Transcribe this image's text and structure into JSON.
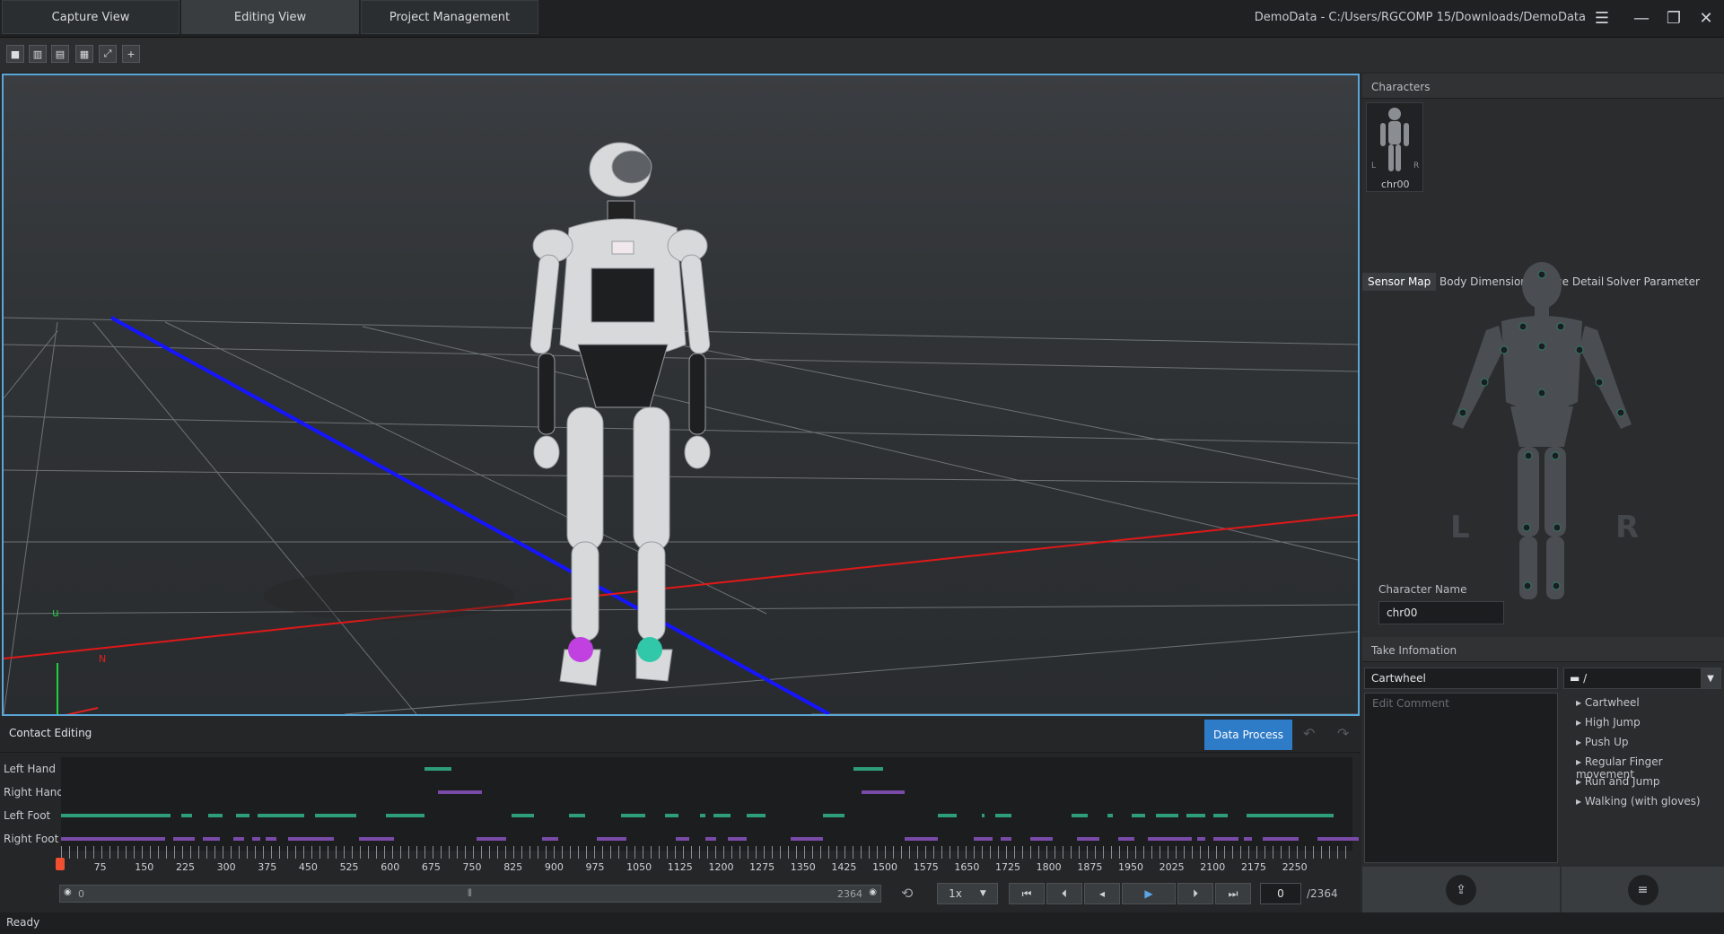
{
  "tabs": [
    {
      "label": "Capture View"
    },
    {
      "label": "Editing View"
    },
    {
      "label": "Project Management"
    }
  ],
  "project_path": "DemoData - C:/Users/RGCOMP 15/Downloads/DemoData",
  "viewport": {
    "axis_u": "u",
    "axis_n": "N"
  },
  "characters": {
    "header": "Characters",
    "thumb_name": "chr00",
    "thumb_l": "L",
    "thumb_r": "R",
    "tabs": [
      "Sensor Map",
      "Body Dimension",
      "Device Detail",
      "Solver Parameter"
    ],
    "big_l": "L",
    "big_r": "R",
    "name_label": "Character Name",
    "name_value": "chr00"
  },
  "take": {
    "header": "Take Infomation",
    "name_value": "Cartwheel",
    "folder_value": "/",
    "comment_placeholder": "Edit Comment",
    "list": [
      "Cartwheel",
      "High Jump",
      "Push Up",
      "Regular Finger movement",
      "Run and Jump",
      "Walking (with gloves)"
    ]
  },
  "contact": {
    "title": "Contact Editing",
    "data_process": "Data Process",
    "tracks": [
      "Left Hand",
      "Right Hand",
      "Left Foot",
      "Right Foot"
    ]
  },
  "timeline": {
    "ticks": [
      "75",
      "150",
      "225",
      "300",
      "375",
      "450",
      "525",
      "600",
      "675",
      "750",
      "825",
      "900",
      "975",
      "1050",
      "1125",
      "1200",
      "1275",
      "1350",
      "1425",
      "1500",
      "1575",
      "1650",
      "1725",
      "1800",
      "1875",
      "1950",
      "2025",
      "2100",
      "2175",
      "2250"
    ],
    "range_start": "0",
    "range_end": "2364",
    "speed": "1x",
    "current_frame": "0",
    "total_frames": "/2364",
    "max_frame": 2364
  },
  "status": "Ready",
  "colors": {
    "accent": "#2e7bc8",
    "left_contact": "#2e9e7a",
    "right_contact": "#7a4aa8"
  },
  "chart_data": {
    "left_hand": [
      [
        665,
        715
      ],
      [
        1450,
        1505
      ]
    ],
    "right_hand": [
      [
        690,
        770
      ],
      [
        1465,
        1545
      ]
    ],
    "left_foot": [
      [
        0,
        200
      ],
      [
        220,
        240
      ],
      [
        270,
        295
      ],
      [
        320,
        345
      ],
      [
        360,
        445
      ],
      [
        465,
        540
      ],
      [
        595,
        665
      ],
      [
        825,
        865
      ],
      [
        930,
        960
      ],
      [
        1025,
        1070
      ],
      [
        1105,
        1130
      ],
      [
        1170,
        1180
      ],
      [
        1195,
        1225
      ],
      [
        1255,
        1290
      ],
      [
        1395,
        1435
      ],
      [
        1605,
        1640
      ],
      [
        1685,
        1690
      ],
      [
        1710,
        1740
      ],
      [
        1850,
        1880
      ],
      [
        1915,
        1925
      ],
      [
        1960,
        1985
      ],
      [
        2005,
        2045
      ],
      [
        2060,
        2095
      ],
      [
        2110,
        2135
      ],
      [
        2170,
        2330
      ]
    ],
    "right_foot": [
      [
        0,
        190
      ],
      [
        205,
        245
      ],
      [
        260,
        290
      ],
      [
        315,
        335
      ],
      [
        350,
        365
      ],
      [
        375,
        395
      ],
      [
        415,
        500
      ],
      [
        545,
        610
      ],
      [
        760,
        815
      ],
      [
        880,
        910
      ],
      [
        980,
        1035
      ],
      [
        1125,
        1150
      ],
      [
        1180,
        1200
      ],
      [
        1220,
        1255
      ],
      [
        1335,
        1395
      ],
      [
        1545,
        1605
      ],
      [
        1670,
        1705
      ],
      [
        1720,
        1740
      ],
      [
        1775,
        1815
      ],
      [
        1860,
        1900
      ],
      [
        1935,
        1965
      ],
      [
        1990,
        2070
      ],
      [
        2080,
        2095
      ],
      [
        2110,
        2155
      ],
      [
        2165,
        2180
      ],
      [
        2200,
        2265
      ],
      [
        2300,
        2375
      ]
    ]
  }
}
